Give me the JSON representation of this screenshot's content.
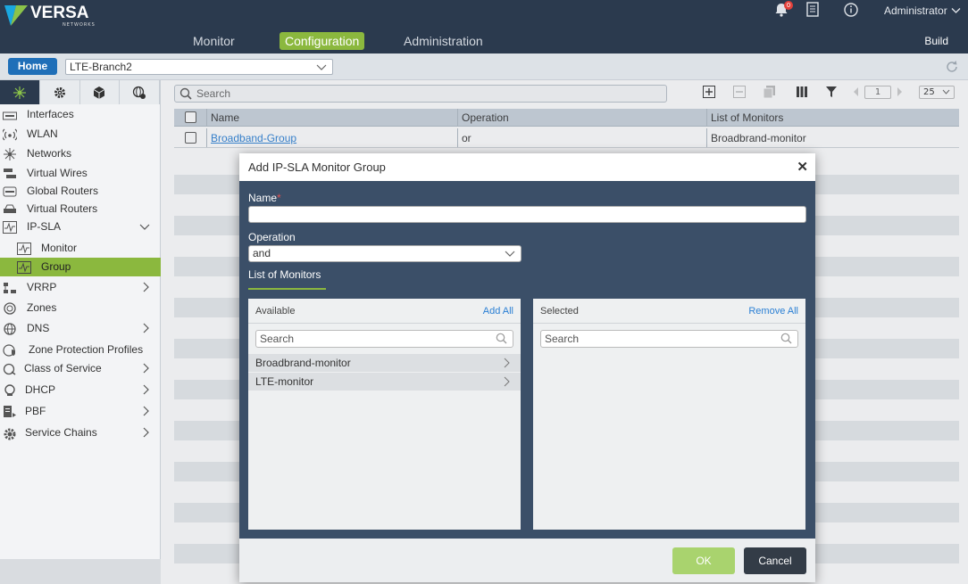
{
  "brand": {
    "name": "VERSA",
    "sub": "NETWORKS"
  },
  "topnav": {
    "monitor": "Monitor",
    "configuration": "Configuration",
    "administration": "Administration",
    "build": "Build"
  },
  "header": {
    "notification_count": "0",
    "user": "Administrator",
    "bell_icon": "bell-icon",
    "doc_icon": "document-icon",
    "info_icon": "info-icon"
  },
  "subbar": {
    "home": "Home",
    "appliance": "LTE-Branch2"
  },
  "sidebar": {
    "tabs": [
      "networking-icon",
      "gear-icon",
      "cube-icon",
      "globe-gear-icon"
    ],
    "items": [
      {
        "label": "Interfaces"
      },
      {
        "label": "WLAN"
      },
      {
        "label": "Networks"
      },
      {
        "label": "Virtual Wires"
      },
      {
        "label": "Global Routers"
      },
      {
        "label": "Virtual Routers"
      },
      {
        "label": "IP-SLA"
      },
      {
        "label": "Monitor"
      },
      {
        "label": "Group"
      },
      {
        "label": "VRRP"
      },
      {
        "label": "Zones"
      },
      {
        "label": "DNS"
      },
      {
        "label": "Zone Protection Profiles"
      },
      {
        "label": "Class of Service"
      },
      {
        "label": "DHCP"
      },
      {
        "label": "PBF"
      },
      {
        "label": "Service Chains"
      }
    ]
  },
  "main": {
    "search_placeholder": "Search",
    "page": "1",
    "per_page": "25",
    "columns": [
      "Name",
      "Operation",
      "List of Monitors"
    ],
    "rows": [
      {
        "name": "Broadband-Group",
        "operation": "or",
        "monitors": "Broadbrand-monitor"
      }
    ]
  },
  "modal": {
    "title": "Add IP-SLA Monitor Group",
    "name_label": "Name",
    "required_mark": "*",
    "name_value": "",
    "operation_label": "Operation",
    "operation_value": "and",
    "list_tab": "List of Monitors",
    "available": {
      "header": "Available",
      "action": "Add All",
      "search_placeholder": "Search",
      "items": [
        "Broadbrand-monitor",
        "LTE-monitor"
      ]
    },
    "selected": {
      "header": "Selected",
      "action": "Remove All",
      "search_placeholder": "Search",
      "items": []
    },
    "ok": "OK",
    "cancel": "Cancel"
  },
  "colors": {
    "topbar": "#2b3a4e",
    "accent": "#8bb83e",
    "modal": "#3b4f68",
    "link": "#2a7fd4"
  }
}
